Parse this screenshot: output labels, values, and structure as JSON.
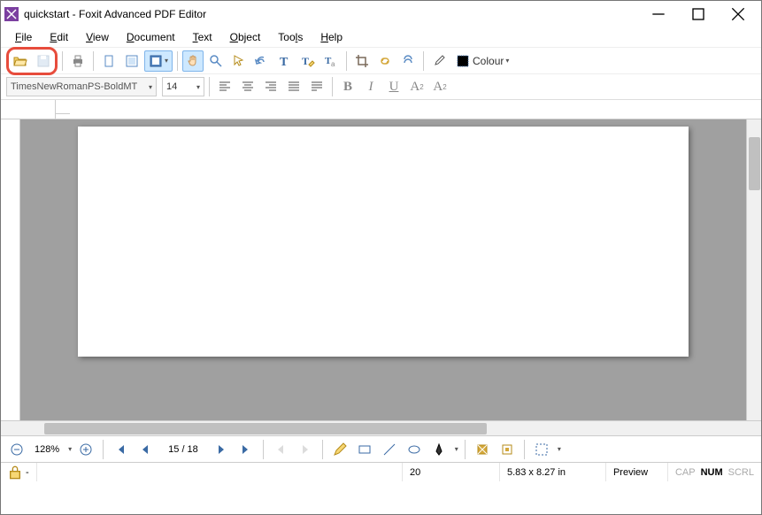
{
  "window": {
    "title": "quickstart - Foxit Advanced PDF Editor"
  },
  "menu": {
    "file": "File",
    "edit": "Edit",
    "view": "View",
    "document": "Document",
    "text": "Text",
    "object": "Object",
    "tools": "Tools",
    "help": "Help"
  },
  "toolbar": {
    "colour_label": "Colour",
    "font_name": "TimesNewRomanPS-BoldMT",
    "font_size": "14",
    "bold": "B",
    "italic": "I",
    "underline": "U",
    "superscript": "A",
    "subscript": "A"
  },
  "nav": {
    "zoom": "128%",
    "page": "15 / 18"
  },
  "status": {
    "lock": "-",
    "x": "20",
    "dims": "5.83 x 8.27 in",
    "preview": "Preview",
    "cap": "CAP",
    "num": "NUM",
    "scrl": "SCRL"
  }
}
